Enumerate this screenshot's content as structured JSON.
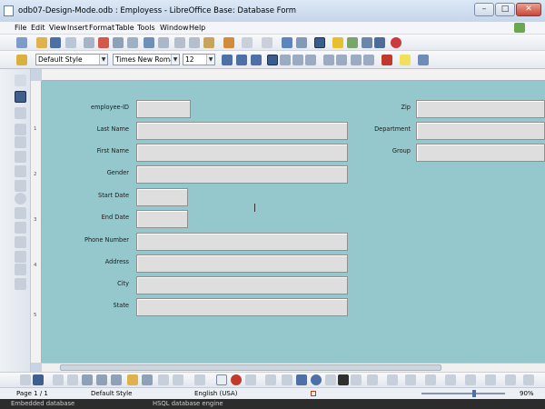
{
  "window": {
    "title": "odb07-Design-Mode.odb : Employess - LibreOffice Base: Database Form",
    "min_glyph": "–",
    "max_glyph": "□",
    "close_glyph": "✕"
  },
  "menu": [
    "File",
    "Edit",
    "View",
    "Insert",
    "Format",
    "Table",
    "Tools",
    "Window",
    "Help"
  ],
  "formatting": {
    "paragraph_style": "Default Style",
    "font_name": "Times New Roman",
    "font_size": "12"
  },
  "ruler_ticks": [
    "1",
    "2",
    "3",
    "4",
    "5"
  ],
  "form": {
    "fields": [
      {
        "label": "employee-ID"
      },
      {
        "label": "Last Name"
      },
      {
        "label": "First Name"
      },
      {
        "label": "Gender"
      },
      {
        "label": "Start Date"
      },
      {
        "label": "End Date"
      },
      {
        "label": "Phone Number"
      },
      {
        "label": "Address"
      },
      {
        "label": "City"
      },
      {
        "label": "State"
      },
      {
        "label": "Zip"
      },
      {
        "label": "Department"
      },
      {
        "label": "Group"
      }
    ]
  },
  "status": {
    "page": "Page 1 / 1",
    "style": "Default Style",
    "language": "English (USA)",
    "zoom": "90%"
  },
  "bottom": {
    "left": "Embedded database",
    "right": "HSQL database engine"
  },
  "colors": {
    "canvas": "#95c8cd",
    "field_bg": "#dedede"
  }
}
